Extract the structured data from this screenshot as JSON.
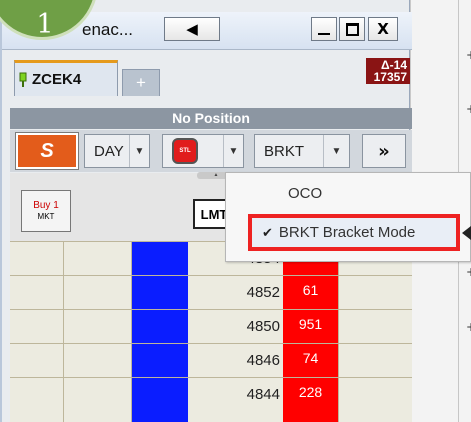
{
  "step_badge": {
    "number": "1"
  },
  "window": {
    "title": "enac...",
    "back_icon": "left-triangle-icon",
    "minimize_icon": "minimize-icon",
    "maximize_icon": "maximize-icon",
    "close_label": "X"
  },
  "tabs": {
    "active": "ZCEK4",
    "add_label": "+"
  },
  "delta": {
    "top": "Δ-14",
    "bottom": "17357"
  },
  "position_status": "No Position",
  "order_bar": {
    "side_label": "S",
    "tif": "DAY",
    "stl_icon_text": "STL",
    "mode": "BRKT",
    "more_label": "»",
    "side_color": "#e35c1b"
  },
  "buttons": {
    "buy_line1": "Buy 1",
    "buy_line2": "MKT",
    "limit_label": "LMT"
  },
  "ladder": {
    "rows": [
      {
        "price": "4854",
        "qty": ""
      },
      {
        "price": "4852",
        "qty": "61"
      },
      {
        "price": "4850",
        "qty": "951"
      },
      {
        "price": "4846",
        "qty": "74"
      },
      {
        "price": "4844",
        "qty": "228"
      }
    ],
    "bid_color": "#0a1dff",
    "ask_color": "#ff0000"
  },
  "menu": {
    "items": [
      {
        "label": "OCO",
        "checked": false
      },
      {
        "label": "BRKT Bracket Mode",
        "checked": true
      }
    ],
    "check_mark": "✔",
    "highlight_color": "#ee2222"
  },
  "right_panel": {
    "plus": "+"
  }
}
